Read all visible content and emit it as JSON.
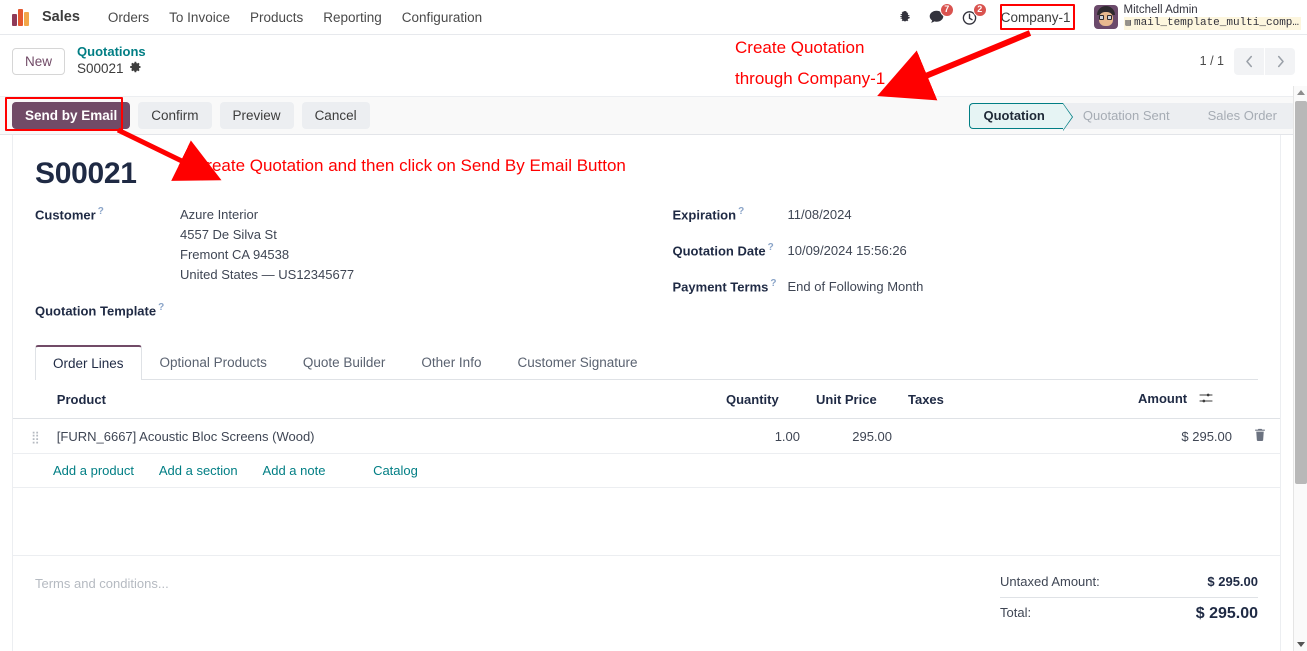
{
  "navbar": {
    "app_name": "Sales",
    "menus": [
      "Orders",
      "To Invoice",
      "Products",
      "Reporting",
      "Configuration"
    ],
    "systray": {
      "debug_icon": "bug-icon",
      "messages_icon": "chat-icon",
      "messages_count": "7",
      "activities_icon": "clock-icon",
      "activities_count": "2",
      "company": "Company-1",
      "user_name": "Mitchell Admin",
      "database": "mail_template_multi_comp…",
      "database_icon": "database-icon",
      "avatar": "user-avatar"
    }
  },
  "control_panel": {
    "new_label": "New",
    "breadcrumb_parent": "Quotations",
    "breadcrumb_current": "S00021",
    "gear_icon": "gear-icon",
    "pager_value": "1 / 1",
    "prev_icon": "chevron-left-icon",
    "next_icon": "chevron-right-icon"
  },
  "action_bar": {
    "primary_button": "Send by Email",
    "buttons": [
      "Confirm",
      "Preview",
      "Cancel"
    ],
    "stages": [
      "Quotation",
      "Quotation Sent",
      "Sales Order"
    ],
    "active_stage": "Quotation"
  },
  "form": {
    "record_title": "S00021",
    "left_fields": [
      {
        "label": "Customer",
        "has_tip": true,
        "value_lines": [
          "Azure Interior",
          "4557 De Silva St",
          "Fremont CA 94538",
          "United States — US12345677"
        ]
      },
      {
        "label": "Quotation Template",
        "has_tip": true,
        "value_lines": [
          ""
        ]
      }
    ],
    "right_fields": [
      {
        "label": "Expiration",
        "has_tip": true,
        "value": "11/08/2024"
      },
      {
        "label": "Quotation Date",
        "has_tip": true,
        "value": "10/09/2024 15:56:26"
      },
      {
        "label": "Payment Terms",
        "has_tip": true,
        "value": "End of Following Month"
      }
    ]
  },
  "notebook": {
    "tabs": [
      "Order Lines",
      "Optional Products",
      "Quote Builder",
      "Other Info",
      "Customer Signature"
    ],
    "active_tab": "Order Lines"
  },
  "order_lines": {
    "headers": {
      "product": "Product",
      "quantity": "Quantity",
      "unit_price": "Unit Price",
      "taxes": "Taxes",
      "amount": "Amount"
    },
    "optional_columns_icon": "column-options-icon",
    "rows": [
      {
        "handle_icon": "drag-handle-icon",
        "product": "[FURN_6667] Acoustic Bloc Screens (Wood)",
        "quantity": "1.00",
        "unit_price": "295.00",
        "taxes": "",
        "amount": "$ 295.00",
        "delete_icon": "trash-icon"
      }
    ],
    "add_links": [
      "Add a product",
      "Add a section",
      "Add a note"
    ],
    "catalog_link": "Catalog"
  },
  "footer": {
    "terms_placeholder": "Terms and conditions...",
    "totals": [
      {
        "label": "Untaxed Amount:",
        "value": "$ 295.00"
      },
      {
        "label": "Total:",
        "value": "$ 295.00"
      }
    ]
  },
  "annotations": {
    "company_note_line1": "Create Quotation",
    "company_note_line2": "through Company-1",
    "email_note": "Create Quotation and then click on Send By Email Button",
    "color": "#ff0000"
  },
  "scrollbar": {
    "up_icon": "scroll-up-arrow",
    "down_icon": "scroll-down-arrow",
    "thumb": "scroll-thumb"
  }
}
